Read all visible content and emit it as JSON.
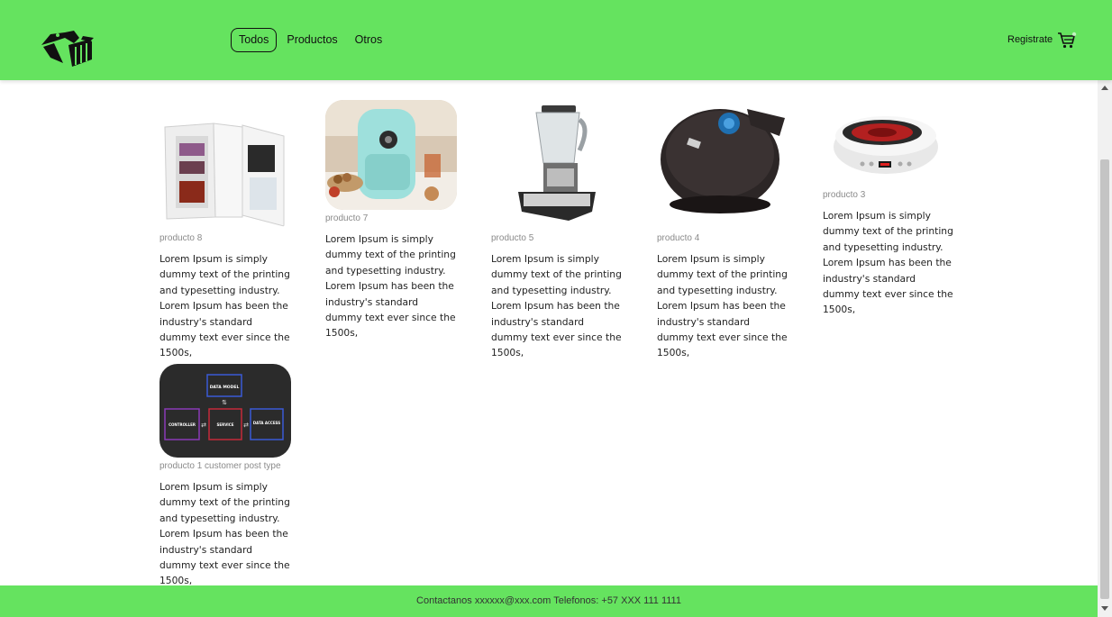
{
  "header": {
    "logo_icon": "store-logo-icon",
    "nav": [
      {
        "label": "Todos",
        "active": true
      },
      {
        "label": "Productos",
        "active": false
      },
      {
        "label": "Otros",
        "active": false
      }
    ],
    "register_label": "Registrate",
    "cart_icon": "cart-icon"
  },
  "products": [
    {
      "name": "producto 8",
      "image": "mini-fridge",
      "description": "Lorem Ipsum is simply dummy text of the printing and typesetting industry. Lorem Ipsum has been the industry's standard dummy text ever since the 1500s,"
    },
    {
      "name": "producto 7",
      "image": "air-fryer",
      "description": "Lorem Ipsum is simply dummy text of the printing and typesetting industry. Lorem Ipsum has been the industry's standard dummy text ever since the 1500s,"
    },
    {
      "name": "producto 5",
      "image": "blender",
      "description": "Lorem Ipsum is simply dummy text of the printing and typesetting industry. Lorem Ipsum has been the industry's standard dummy text ever since the 1500s,"
    },
    {
      "name": "producto 4",
      "image": "waffle-maker",
      "description": "Lorem Ipsum is simply dummy text of the printing and typesetting industry. Lorem Ipsum has been the industry's standard dummy text ever since the 1500s,"
    },
    {
      "name": "producto 3",
      "image": "induction-hob",
      "description": "Lorem Ipsum is simply dummy text of the printing and typesetting industry. Lorem Ipsum has been the industry's standard dummy text ever since the 1500s,"
    },
    {
      "name": "producto 1 customer post type",
      "image": "architecture-diagram",
      "description": "Lorem Ipsum is simply dummy text of the printing and typesetting industry. Lorem Ipsum has been the industry's standard dummy text ever since the 1500s,",
      "diagram_labels": {
        "top": "DATA MODEL",
        "left": "CONTROLLER",
        "middle": "SERVICE",
        "right": "DATA ACCESS"
      }
    }
  ],
  "footer": {
    "text": "Contactanos xxxxxx@xxx.com Telefonos: +57 XXX 111 1111"
  },
  "colors": {
    "header_bg": "#65e35f",
    "footer_bg": "#65e35f"
  }
}
